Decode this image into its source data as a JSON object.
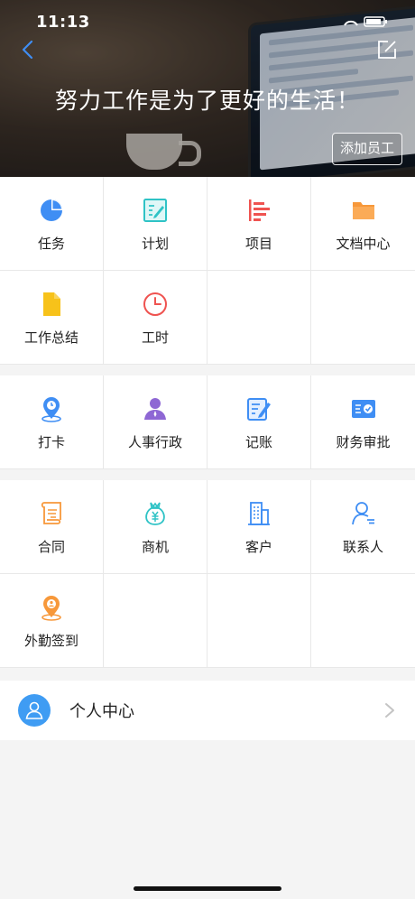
{
  "status_bar": {
    "time": "11:13"
  },
  "header": {
    "slogan": "努力工作是为了更好的生活！",
    "add_employee_label": "添加员工"
  },
  "section1": {
    "items": [
      {
        "label": "任务",
        "icon": "pie-chart-icon",
        "color": "#3f8ef4"
      },
      {
        "label": "计划",
        "icon": "edit-document-icon",
        "color": "#2fc3c6"
      },
      {
        "label": "项目",
        "icon": "bar-list-icon",
        "color": "#ef5350"
      },
      {
        "label": "文档中心",
        "icon": "folder-icon",
        "color": "#f7983a"
      },
      {
        "label": "工作总结",
        "icon": "file-icon",
        "color": "#f7c21a"
      },
      {
        "label": "工时",
        "icon": "clock-icon",
        "color": "#ef5350"
      }
    ]
  },
  "section2": {
    "items": [
      {
        "label": "打卡",
        "icon": "location-clock-icon",
        "color": "#3f8ef4"
      },
      {
        "label": "人事行政",
        "icon": "person-icon",
        "color": "#8e67d4"
      },
      {
        "label": "记账",
        "icon": "note-edit-icon",
        "color": "#3f8ef4"
      },
      {
        "label": "财务审批",
        "icon": "approval-card-icon",
        "color": "#3f8ef4"
      }
    ]
  },
  "section3": {
    "items": [
      {
        "label": "合同",
        "icon": "scroll-contract-icon",
        "color": "#f7983a"
      },
      {
        "label": "商机",
        "icon": "money-bag-icon",
        "color": "#2fc3c6"
      },
      {
        "label": "客户",
        "icon": "building-icon",
        "color": "#3f8ef4"
      },
      {
        "label": "联系人",
        "icon": "contact-person-icon",
        "color": "#3f8ef4"
      },
      {
        "label": "外勤签到",
        "icon": "location-person-icon",
        "color": "#f7983a"
      }
    ]
  },
  "profile": {
    "label": "个人中心",
    "icon": "user-avatar-icon"
  }
}
